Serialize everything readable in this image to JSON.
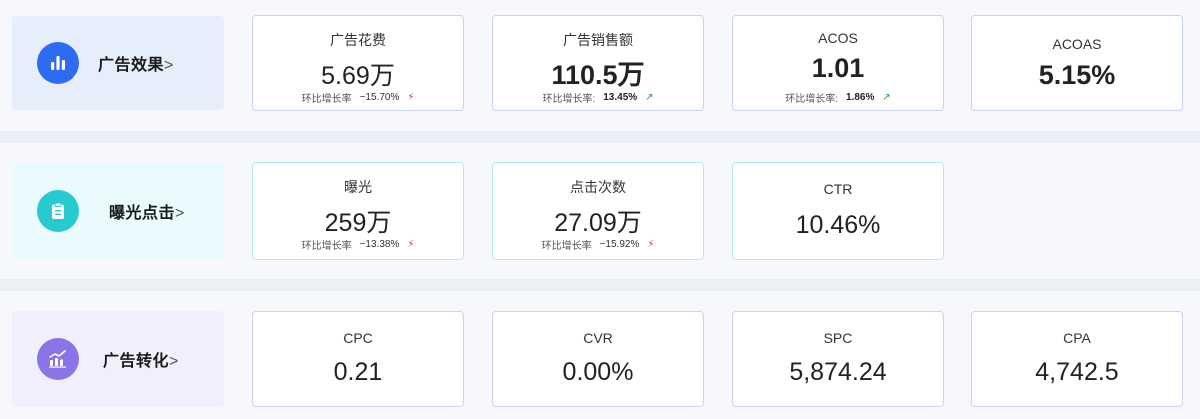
{
  "sections": [
    {
      "label": "广告效果",
      "arrow": ">",
      "icon": "bar-chart-icon",
      "color": "#2f6bf0",
      "metrics": [
        {
          "title": "广告花费",
          "value": "5.69万",
          "change_label": "环比增长率",
          "change": "−15.70%",
          "trend": "down"
        },
        {
          "title": "广告销售额",
          "value": "110.5万",
          "change_label": "环比增长率:",
          "change": "13.45%",
          "trend": "up"
        },
        {
          "title": "ACOS",
          "value": "1.01",
          "change_label": "环比增长率:",
          "change": "1.86%",
          "trend": "up"
        },
        {
          "title": "ACOAS",
          "value": "5.15%"
        }
      ]
    },
    {
      "label": "曝光点击",
      "arrow": ">",
      "icon": "clipboard-icon",
      "color": "#28c9cf",
      "metrics": [
        {
          "title": "曝光",
          "value": "259万",
          "change_label": "环比增长率",
          "change": "−13.38%",
          "trend": "down"
        },
        {
          "title": "点击次数",
          "value": "27.09万",
          "change_label": "环比增长率",
          "change": "−15.92%",
          "trend": "down"
        },
        {
          "title": "CTR",
          "value": "10.46%"
        }
      ]
    },
    {
      "label": "广告转化",
      "arrow": ">",
      "icon": "trend-chart-icon",
      "color": "#8b74e8",
      "metrics": [
        {
          "title": "CPC",
          "value": "0.21"
        },
        {
          "title": "CVR",
          "value": "0.00%"
        },
        {
          "title": "SPC",
          "value": "5,874.24"
        },
        {
          "title": "CPA",
          "value": "4,742.5"
        }
      ]
    }
  ],
  "trend_icons": {
    "down": "⚡",
    "up": "↗"
  }
}
